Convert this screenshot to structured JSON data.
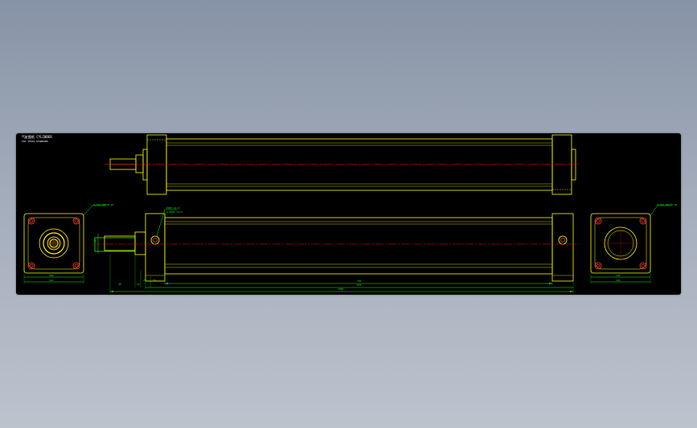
{
  "viewer": {
    "background_color": "#9aa3b2",
    "canvas_color": "#000000"
  },
  "drawing": {
    "title_block": {
      "line1": "气缸图纸 CYLINDER",
      "line2": "ISO 15552 STANDARD"
    },
    "callouts": {
      "front_port": "PORT G1/4",
      "rear_port": "PORT G1/4",
      "front_view_note": "4-M10 DEPTH 20",
      "rear_view_note": "4-M10 DEPTH 20",
      "port_sub": "2-PORT G1/4"
    },
    "dimensions": {
      "stroke": "700",
      "body": "874",
      "overall": "1068",
      "rod": "32",
      "rod_ext": "48",
      "small_a": "15",
      "small_b": "25",
      "small_c": "30",
      "bore": "130",
      "flange": "100",
      "width_left": "116",
      "width_right": "116",
      "height_left": "100"
    },
    "colors": {
      "outline": "#ffff00",
      "hidden": "#ffff00",
      "centerline": "#ff0000",
      "dimension": "#00ff00",
      "bolt": "#ff3b30",
      "text": "#00ff00",
      "accent": "#ffffff"
    }
  }
}
